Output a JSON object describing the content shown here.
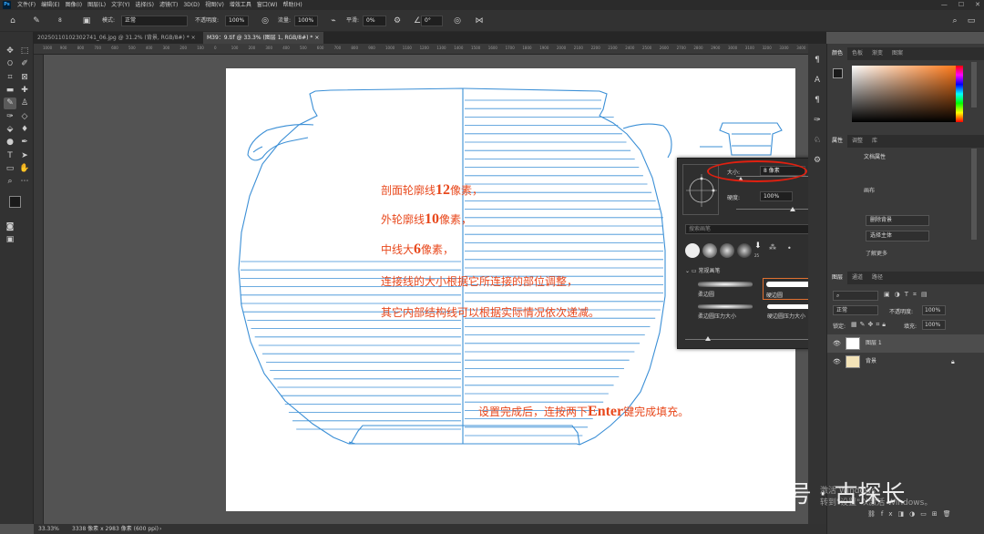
{
  "app": {
    "logo": "Ps",
    "menu": [
      "文件(F)",
      "编辑(E)",
      "图像(I)",
      "图层(L)",
      "文字(Y)",
      "选择(S)",
      "滤镜(T)",
      "3D(D)",
      "视图(V)",
      "增效工具",
      "窗口(W)",
      "帮助(H)"
    ],
    "window_controls": [
      "—",
      "☐",
      "✕"
    ]
  },
  "options_bar": {
    "brush_size": "8",
    "mode_label": "模式:",
    "mode_value": "正常",
    "opacity_label": "不透明度:",
    "opacity_value": "100%",
    "flow_label": "流量:",
    "flow_value": "100%",
    "smooth_label": "平滑:",
    "smooth_value": "0%",
    "angle_value": "0°"
  },
  "tabs": [
    {
      "label": "20250110102302741_06.jpg @ 31.2% (背景, RGB/8#) *",
      "close": "×"
    },
    {
      "label": "M39：9.tif @ 33.3% (图层 1, RGB/8#) *",
      "close": "×"
    }
  ],
  "ruler_ticks": [
    "1000",
    "900",
    "800",
    "700",
    "600",
    "500",
    "400",
    "300",
    "200",
    "100",
    "0",
    "100",
    "200",
    "300",
    "400",
    "500",
    "600",
    "700",
    "800",
    "900",
    "1000",
    "1100",
    "1200",
    "1300",
    "1400",
    "1500",
    "1600",
    "1700",
    "1800",
    "1900",
    "2000",
    "2100",
    "2200",
    "2300",
    "2400",
    "2500",
    "2600",
    "2700",
    "2800",
    "2900",
    "3000",
    "3100",
    "3200",
    "3300",
    "3400",
    "3500",
    "3600"
  ],
  "canvas_annotations": {
    "line1_pre": "剖面轮廓线",
    "line1_num": "12",
    "line1_post": "像素，",
    "line2_pre": "外轮廓线",
    "line2_num": "10",
    "line2_post": "像素，",
    "line3_pre": "中线大",
    "line3_num": "6",
    "line3_post": "像素，",
    "line4": "连接线的大小根据它所连接的部位调整，",
    "line5": "其它内部结构线可以根据实际情况依次递减。",
    "line6_pre": "设置完成后，连按两下",
    "line6_key": "Enter",
    "line6_post": "键完成填充。"
  },
  "brush_popup": {
    "size_label": "大小:",
    "size_value": "8 像素",
    "hardness_label": "硬度:",
    "hardness_value": "100%",
    "search_placeholder": "搜索画笔",
    "preset_25": "25",
    "group_label": "常规画笔",
    "presets": [
      "柔边圆",
      "硬边圆",
      "柔边圆压力大小",
      "硬边圆压力大小"
    ]
  },
  "right_panel": {
    "color_tabs": [
      "颜色",
      "色板",
      "渐变",
      "图案"
    ],
    "props_tabs": [
      "属性",
      "调整",
      "库"
    ],
    "props_title": "文档属性",
    "props_items": [
      "画布",
      "删除背景",
      "选择主体",
      "了解更多"
    ],
    "layers_tabs": [
      "图层",
      "通道",
      "路径"
    ],
    "layers_mode": "正常",
    "opacity_label": "不透明度:",
    "opacity_value": "100%",
    "lock_label": "锁定:",
    "fill_label": "填充:",
    "fill_value": "100%",
    "layers": [
      {
        "name": "图层 1"
      },
      {
        "name": "背景"
      }
    ]
  },
  "status": {
    "zoom": "33.33%",
    "doc_info": "3338 像素 x 2983 像素 (600 ppi)",
    "arrow": "›"
  },
  "watermark": {
    "text": "服务号 · 古探长",
    "windows_activate_1": "激活 Windows",
    "windows_activate_2": "转到\"设置\"以激活 Windows。"
  },
  "colors": {
    "annotation_red": "#e8481c",
    "vessel_line": "#3b8fd6",
    "highlight_circle": "#e02010",
    "foreground": "#1a1a1a",
    "background": "#ffffff"
  }
}
